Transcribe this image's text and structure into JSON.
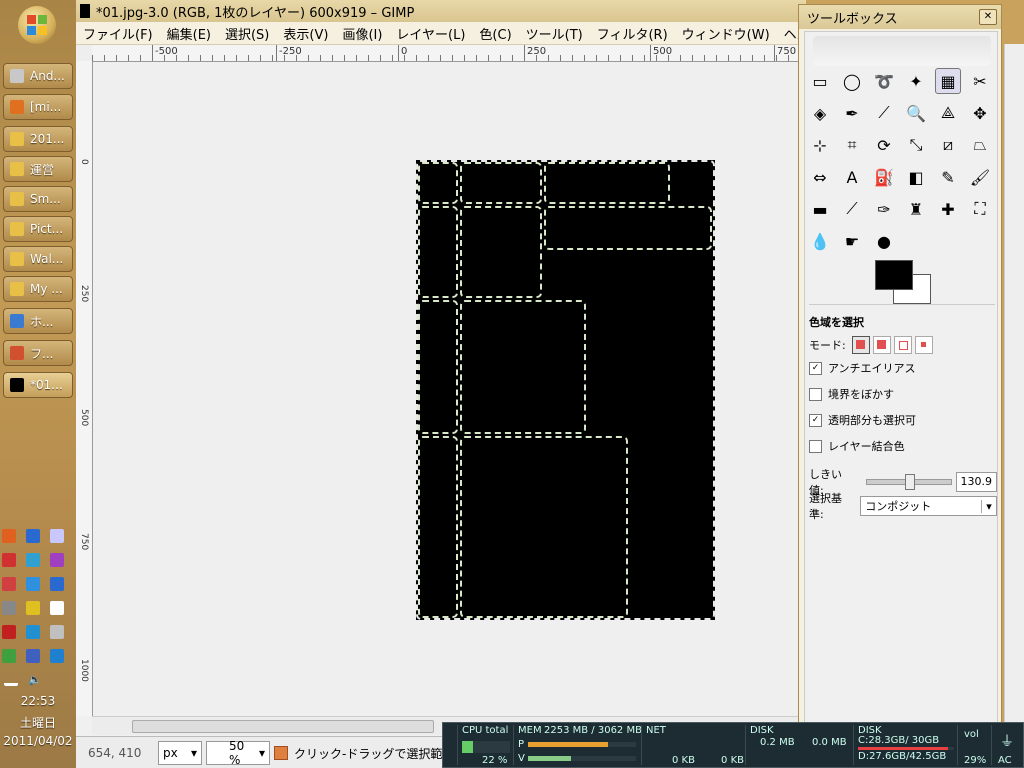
{
  "taskbar": {
    "buttons": [
      {
        "label": "And...",
        "icon": "java-icon",
        "color": "#c8c8c8"
      },
      {
        "label": "[mi...",
        "icon": "firefox-icon",
        "color": "#e07020"
      },
      {
        "label": "201...",
        "icon": "folder-icon",
        "color": "#e8c048"
      },
      {
        "label": "運営",
        "icon": "folder-icon",
        "color": "#e8c048"
      },
      {
        "label": "Sm...",
        "icon": "folder-icon",
        "color": "#e8c048"
      },
      {
        "label": "Pict...",
        "icon": "folder-icon",
        "color": "#e8c048"
      },
      {
        "label": "Wal...",
        "icon": "folder-icon",
        "color": "#e8c048"
      },
      {
        "label": "My ...",
        "icon": "folder-icon",
        "color": "#e8c048"
      },
      {
        "label": "ホ...",
        "icon": "browser-icon",
        "color": "#3a7ad0"
      },
      {
        "label": "フ...",
        "icon": "app-icon",
        "color": "#d05030"
      },
      {
        "label": "*01...",
        "icon": "gimp-image-icon",
        "color": "#000000"
      }
    ],
    "clock": {
      "time": "22:53",
      "day": "土曜日",
      "date": "2011/04/02"
    }
  },
  "gimp": {
    "title": "*01.jpg-3.0 (RGB, 1枚のレイヤー) 600x919 – GIMP",
    "menus": [
      "ファイル(F)",
      "編集(E)",
      "選択(S)",
      "表示(V)",
      "画像(I)",
      "レイヤー(L)",
      "色(C)",
      "ツール(T)",
      "フィルタ(R)",
      "ウィンドウ(W)",
      "ヘルプ(H)"
    ],
    "ruler_labels": [
      "-500",
      "-250",
      "0",
      "250",
      "500",
      "750"
    ],
    "vruler_labels": [
      "0",
      "250",
      "500",
      "750",
      "1000"
    ],
    "status": {
      "coords": "654, 410",
      "unit": "px",
      "zoom": "50 %",
      "message": "クリック-ドラッグで選択範囲を作成します (Shift, Ctrl, Alt も使えます)"
    }
  },
  "toolbox": {
    "title": "ツールボックス",
    "options_title": "色域を選択",
    "mode_label": "モード:",
    "options": [
      {
        "label": "アンチエイリアス",
        "checked": true
      },
      {
        "label": "境界をぼかす",
        "checked": false
      },
      {
        "label": "透明部分も選択可",
        "checked": true
      },
      {
        "label": "レイヤー結合色",
        "checked": false
      }
    ],
    "threshold_label": "しきい値:",
    "threshold_value": "130.9",
    "criterion_label": "選択基準:",
    "criterion_value": "コンポジット"
  },
  "sysmon": {
    "cpu_label": "CPU total",
    "cpu_pct": "22 %",
    "mem_label": "MEM",
    "mem_value": "2253 MB / 3062 MB",
    "mem_p": "P",
    "mem_v": "V",
    "net_label": "NET",
    "net_up": "0 KB",
    "net_down": "0 KB",
    "disk1_label": "DISK",
    "disk1_r": "0.2 MB",
    "disk1_w": "0.0 MB",
    "disk2_label": "DISK",
    "disk2_c": "C:28.3GB/ 30GB",
    "disk2_d": "D:27.6GB/42.5GB",
    "vol_label": "vol",
    "vol_pct": "29%",
    "ac_label": "AC"
  }
}
